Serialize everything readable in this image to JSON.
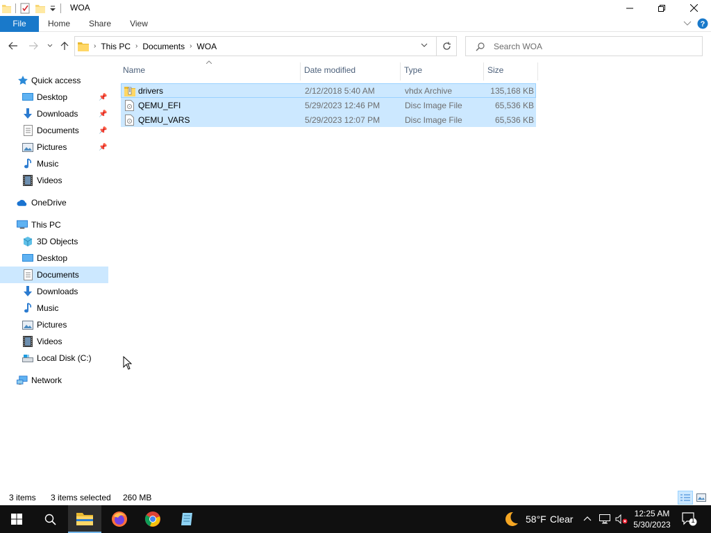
{
  "window": {
    "title": "WOA",
    "buttons": {
      "minimize": "minimize",
      "maximize": "restore",
      "close": "close"
    }
  },
  "ribbon": {
    "tabs": [
      "File",
      "Home",
      "Share",
      "View"
    ]
  },
  "address": {
    "crumbs": [
      "This PC",
      "Documents",
      "WOA"
    ]
  },
  "search": {
    "placeholder": "Search WOA"
  },
  "nav": {
    "quick_access": "Quick access",
    "quick_items": [
      "Desktop",
      "Downloads",
      "Documents",
      "Pictures",
      "Music",
      "Videos"
    ],
    "onedrive": "OneDrive",
    "this_pc": "This PC",
    "pc_items": [
      "3D Objects",
      "Desktop",
      "Documents",
      "Downloads",
      "Music",
      "Pictures",
      "Videos",
      "Local Disk (C:)"
    ],
    "network": "Network",
    "selected": "Documents"
  },
  "columns": [
    "Name",
    "Date modified",
    "Type",
    "Size"
  ],
  "files": [
    {
      "name": "drivers",
      "date": "2/12/2018 5:40 AM",
      "type": "vhdx Archive",
      "size": "135,168 KB",
      "icon": "archive-icon"
    },
    {
      "name": "QEMU_EFI",
      "date": "5/29/2023 12:46 PM",
      "type": "Disc Image File",
      "size": "65,536 KB",
      "icon": "disc-image-icon"
    },
    {
      "name": "QEMU_VARS",
      "date": "5/29/2023 12:07 PM",
      "type": "Disc Image File",
      "size": "65,536 KB",
      "icon": "disc-image-icon"
    }
  ],
  "status": {
    "items": "3 items",
    "selected": "3 items selected",
    "size": "260 MB"
  },
  "taskbar": {
    "weather_temp": "58°F",
    "weather_text": "Clear",
    "time": "12:25 AM",
    "date": "5/30/2023",
    "notifications": "1"
  },
  "colors": {
    "accent": "#1979ca",
    "selection": "#cce8ff",
    "taskbar": "#101010"
  }
}
